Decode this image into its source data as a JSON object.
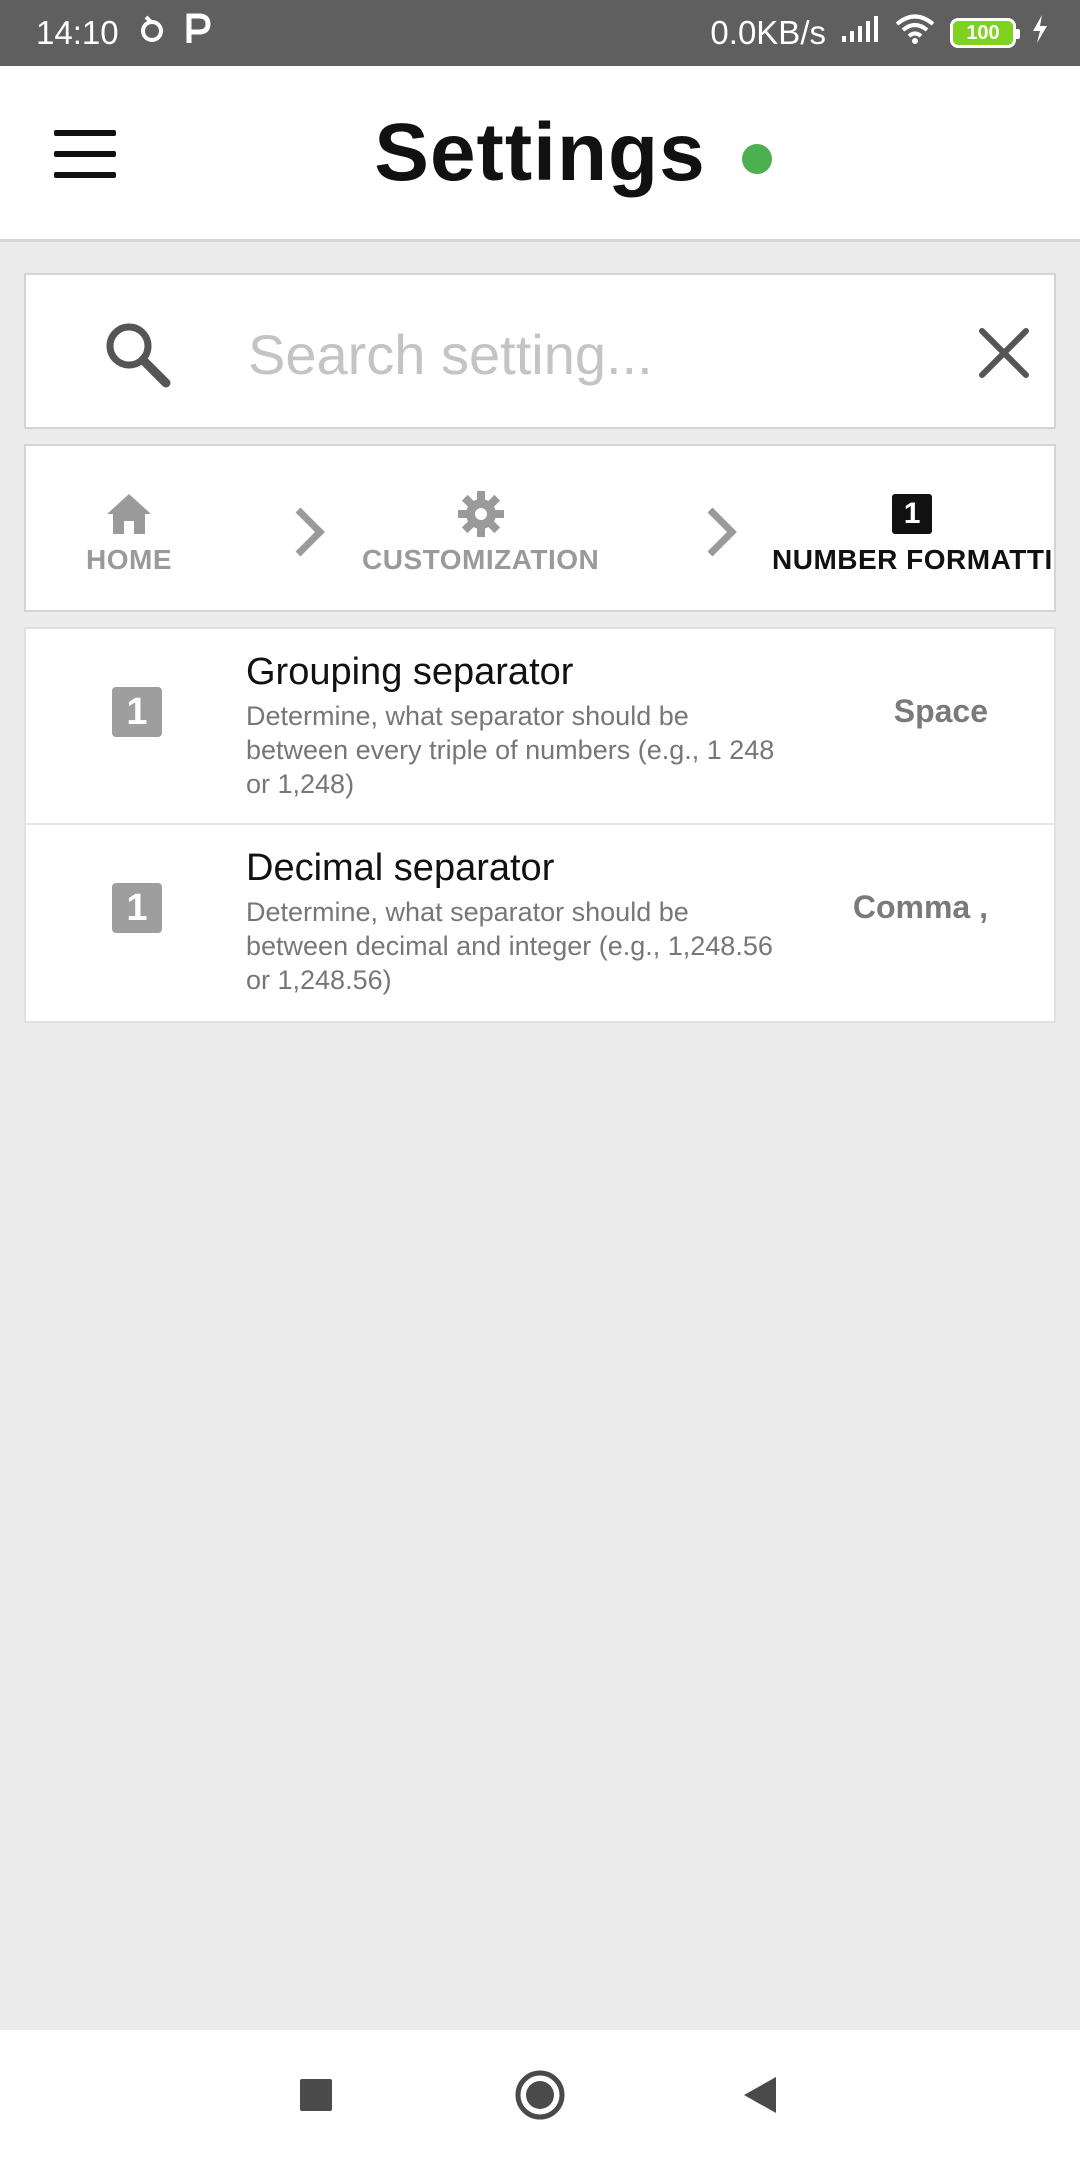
{
  "status_bar": {
    "time": "14:10",
    "net_speed": "0.0KB/s",
    "battery": "100"
  },
  "header": {
    "title": "Settings",
    "status_dot_color": "#4caf50"
  },
  "search": {
    "placeholder": "Search setting...",
    "value": ""
  },
  "breadcrumb": {
    "items": [
      {
        "label": "HOME",
        "icon": "home-icon"
      },
      {
        "label": "CUSTOMIZATION",
        "icon": "gear-icon"
      },
      {
        "label": "NUMBER FORMATTI",
        "icon": "number-one-badge"
      }
    ],
    "current_badge": "1"
  },
  "settings": [
    {
      "badge": "1",
      "title": "Grouping separator",
      "description": "Determine, what separator should be between every triple of numbers (e.g., 1 248 or 1,248)",
      "value": "Space"
    },
    {
      "badge": "1",
      "title": "Decimal separator",
      "description": "Determine, what separator should be between decimal and integer (e.g., 1,248.56 or 1,248.56)",
      "value": "Comma ,"
    }
  ]
}
